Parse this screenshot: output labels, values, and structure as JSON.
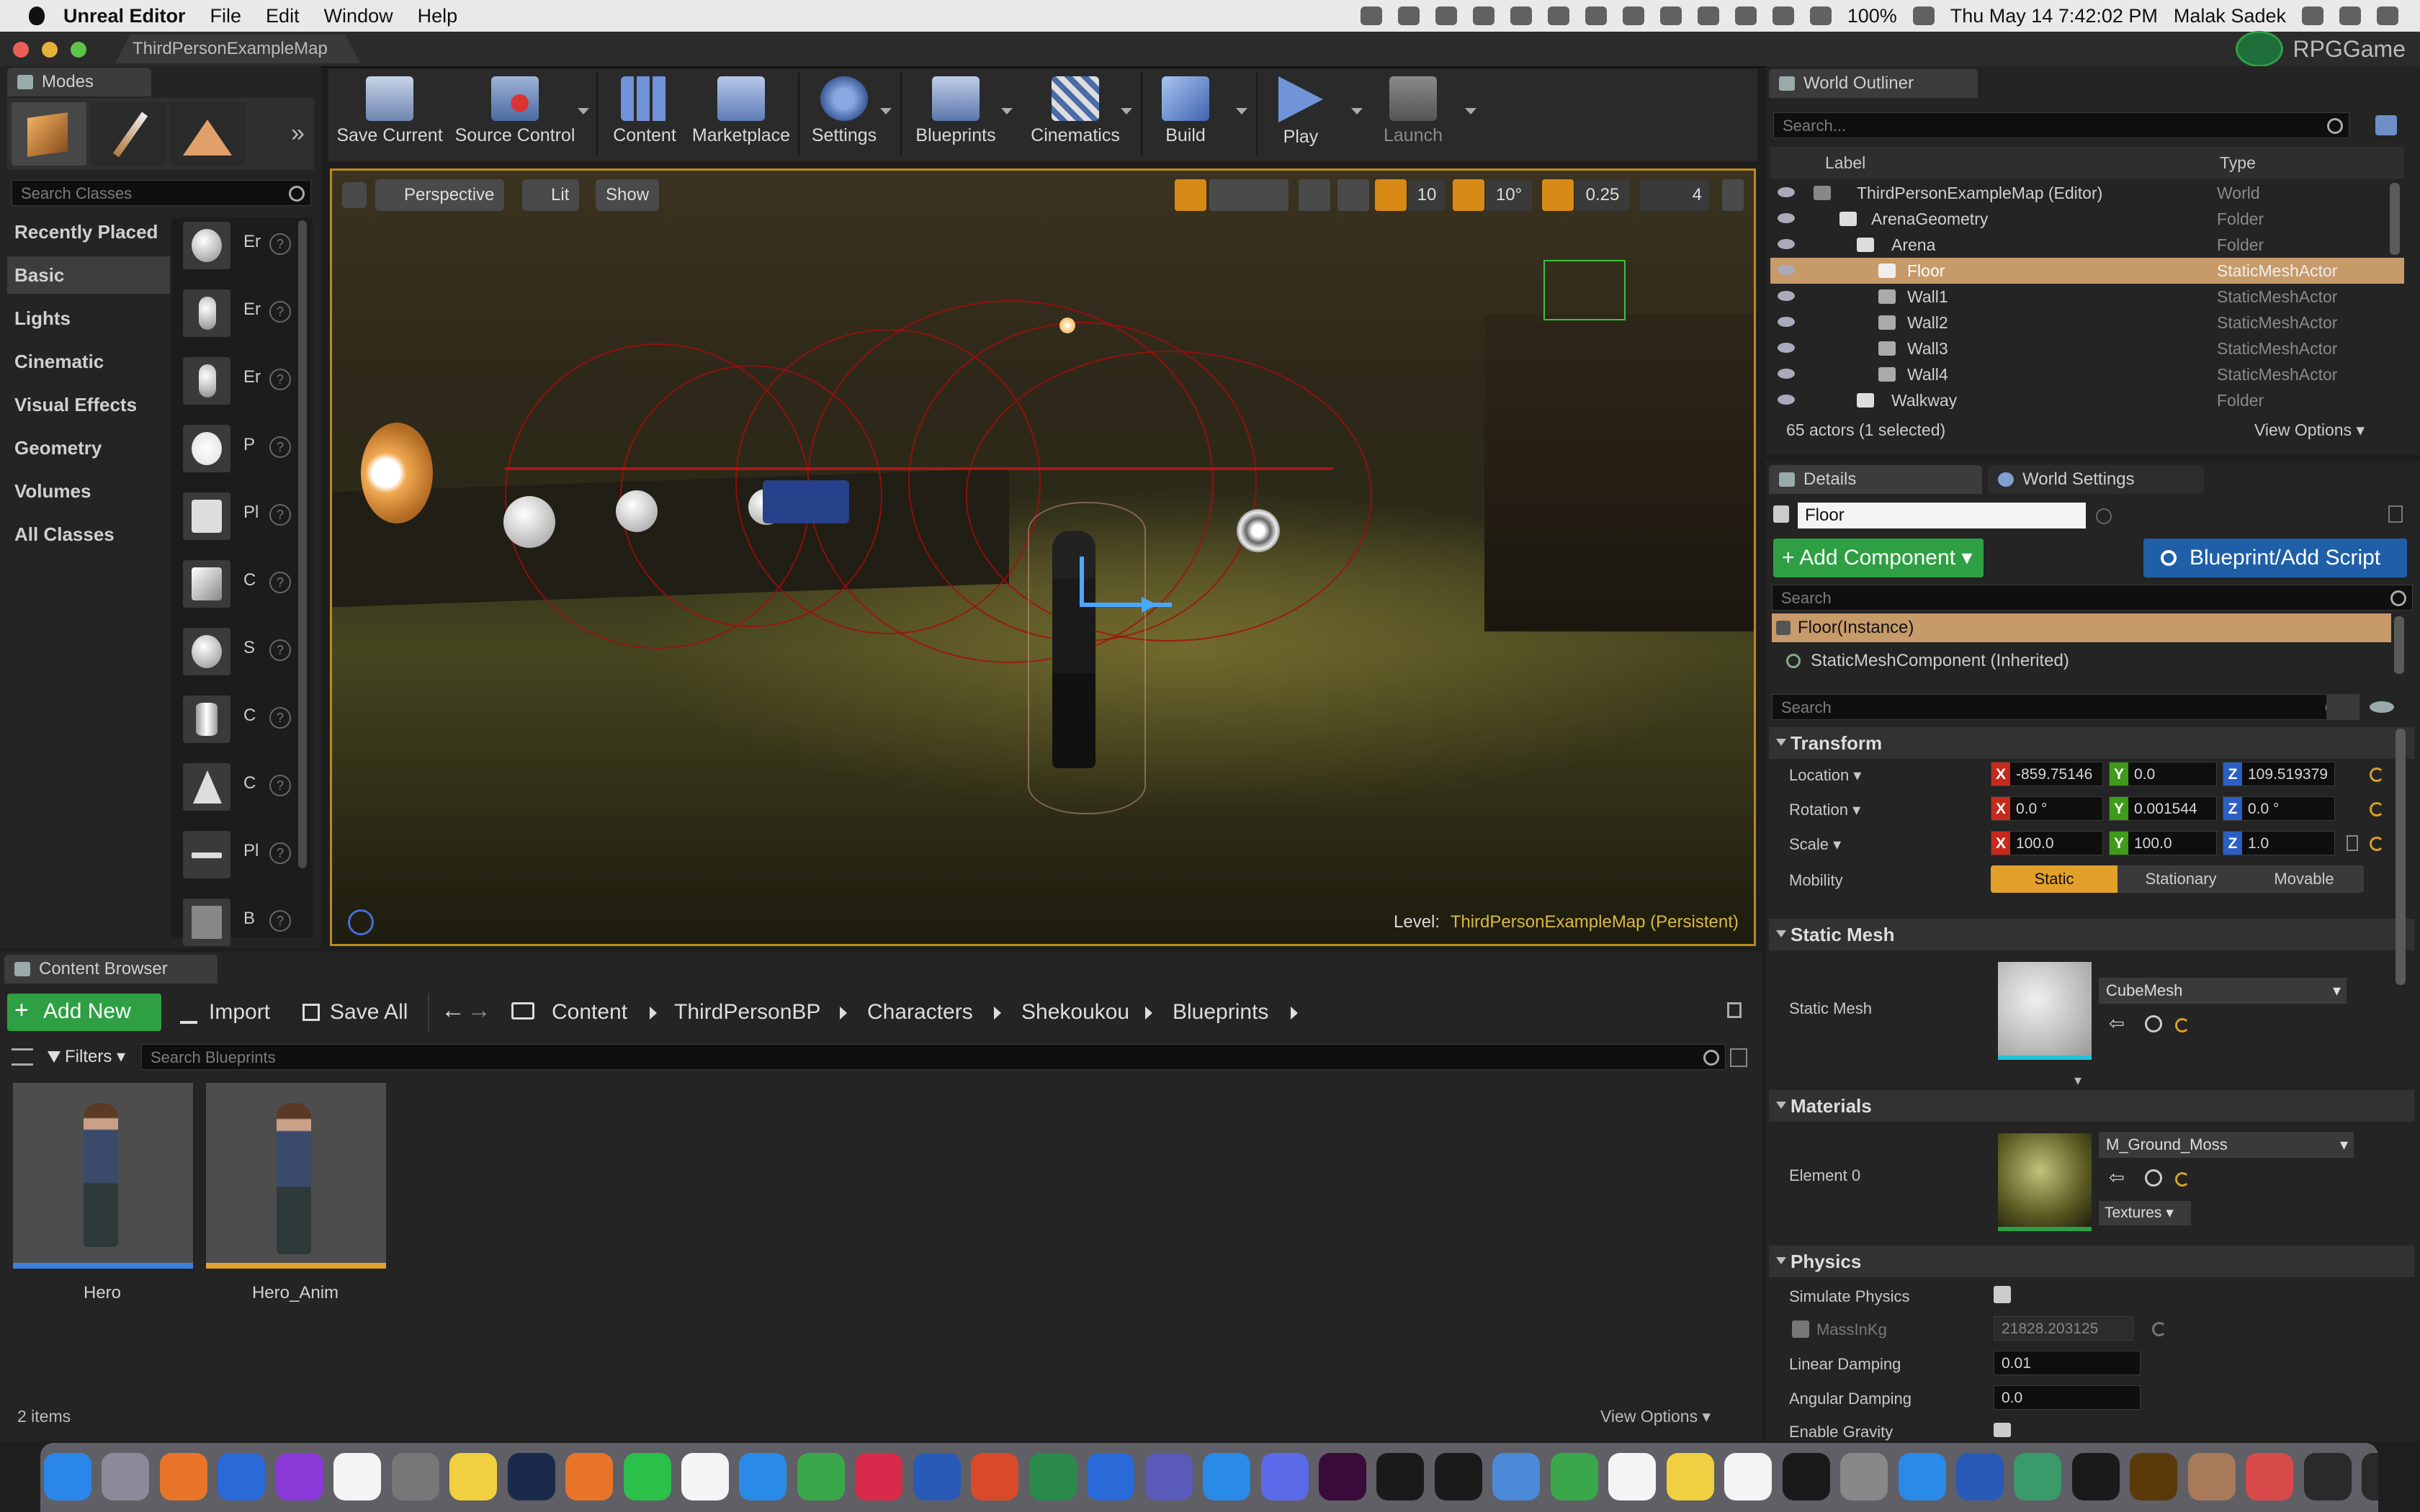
{
  "menubar": {
    "app": "Unreal Editor",
    "items": [
      "File",
      "Edit",
      "Window",
      "Help"
    ],
    "battery": "100%",
    "datetime": "Thu May 14  7:42:02 PM",
    "user": "Malak Sadek"
  },
  "window": {
    "tab": "ThirdPersonExampleMap",
    "project": "RPGGame"
  },
  "modes": {
    "tab": "Modes",
    "search_placeholder": "Search Classes",
    "categories": [
      "Recently Placed",
      "Basic",
      "Lights",
      "Cinematic",
      "Visual Effects",
      "Geometry",
      "Volumes",
      "All Classes"
    ],
    "selected_category": "Basic",
    "items": [
      "Er",
      "Er",
      "Er",
      "P",
      "Pl",
      "C",
      "S",
      "C",
      "C",
      "Pl",
      "B"
    ]
  },
  "toolbar": {
    "buttons": [
      "Save Current",
      "Source Control",
      "Content",
      "Marketplace",
      "Settings",
      "Blueprints",
      "Cinematics",
      "Build",
      "Play",
      "Launch"
    ]
  },
  "viewport": {
    "perspective": "Perspective",
    "lit": "Lit",
    "show": "Show",
    "grid_snap": "10",
    "rot_snap": "10°",
    "scale_snap": "0.25",
    "cam_speed": "4",
    "level_label": "Level:",
    "level_name": "ThirdPersonExampleMap (Persistent)"
  },
  "content_browser": {
    "tab": "Content Browser",
    "add_new": "Add New",
    "import": "Import",
    "save_all": "Save All",
    "breadcrumbs": [
      "Content",
      "ThirdPersonBP",
      "Characters",
      "Shekoukou",
      "Blueprints"
    ],
    "filters": "Filters",
    "search_placeholder": "Search Blueprints",
    "assets": [
      "Hero",
      "Hero_Anim"
    ],
    "count": "2 items",
    "view_options": "View Options"
  },
  "outliner": {
    "tab": "World Outliner",
    "search_placeholder": "Search...",
    "col_label": "Label",
    "col_type": "Type",
    "rows": [
      {
        "label": "ThirdPersonExampleMap (Editor)",
        "type": "World"
      },
      {
        "label": "ArenaGeometry",
        "type": "Folder"
      },
      {
        "label": "Arena",
        "type": "Folder"
      },
      {
        "label": "Floor",
        "type": "StaticMeshActor"
      },
      {
        "label": "Wall1",
        "type": "StaticMeshActor"
      },
      {
        "label": "Wall2",
        "type": "StaticMeshActor"
      },
      {
        "label": "Wall3",
        "type": "StaticMeshActor"
      },
      {
        "label": "Wall4",
        "type": "StaticMeshActor"
      },
      {
        "label": "Walkway",
        "type": "Folder"
      }
    ],
    "status": "65 actors (1 selected)",
    "view_options": "View Options"
  },
  "details": {
    "tab": "Details",
    "tab2": "World Settings",
    "name": "Floor",
    "add_component": "+ Add Component",
    "blueprint_script": "Blueprint/Add Script",
    "search_placeholder": "Search",
    "instance": "Floor(Instance)",
    "component": "StaticMeshComponent (Inherited)",
    "search2_placeholder": "Search",
    "transform": {
      "title": "Transform",
      "location_label": "Location",
      "location": [
        "-859.75146",
        "0.0",
        "109.519379"
      ],
      "rotation_label": "Rotation",
      "rotation": [
        "0.0 °",
        "0.001544",
        "0.0 °"
      ],
      "scale_label": "Scale",
      "scale": [
        "100.0",
        "100.0",
        "1.0"
      ],
      "mobility_label": "Mobility",
      "mobility": [
        "Static",
        "Stationary",
        "Movable"
      ]
    },
    "static_mesh": {
      "title": "Static Mesh",
      "label": "Static Mesh",
      "value": "CubeMesh"
    },
    "materials": {
      "title": "Materials",
      "label": "Element 0",
      "value": "M_Ground_Moss",
      "textures": "Textures"
    },
    "physics": {
      "title": "Physics",
      "simulate": "Simulate Physics",
      "mass_label": "MassInKg",
      "mass": "21828.203125",
      "linear_label": "Linear Damping",
      "linear": "0.01",
      "angular_label": "Angular Damping",
      "angular": "0.0",
      "gravity": "Enable Gravity"
    }
  },
  "colors": {
    "viewport_border": "#b98b1c",
    "selection": "#c79a6a",
    "add_green": "#2ea043",
    "blueprint_blue": "#1f5fa8",
    "static_orange": "#e2a02a"
  }
}
